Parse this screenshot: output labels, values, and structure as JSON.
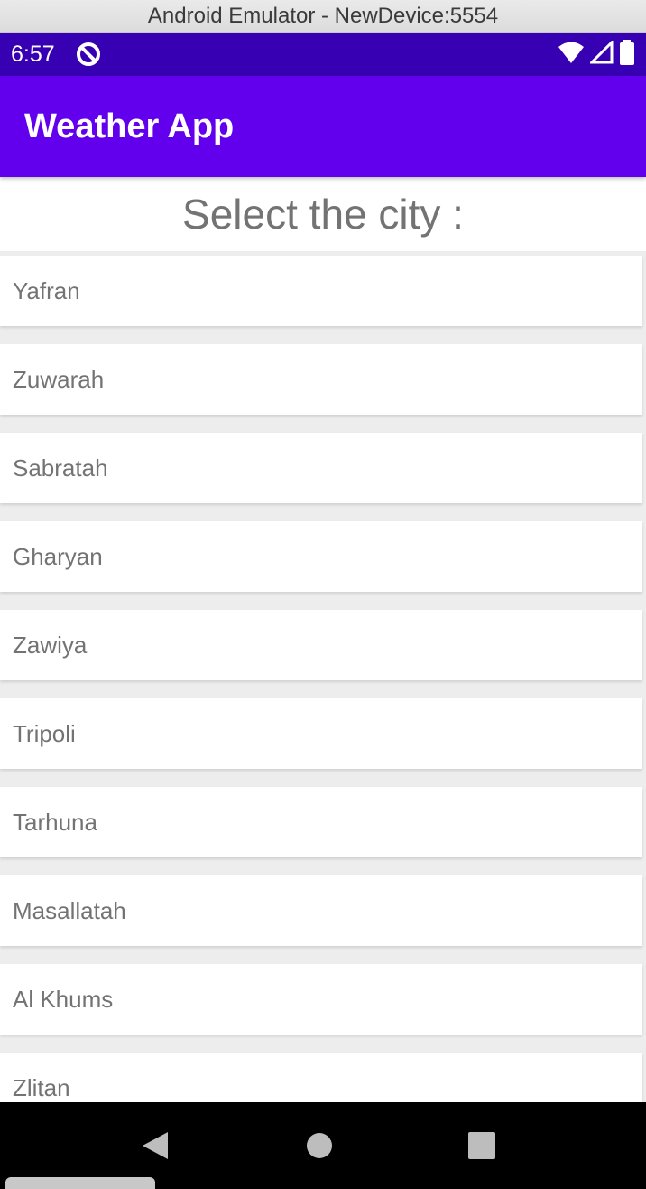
{
  "window": {
    "title": "Android Emulator - NewDevice:5554"
  },
  "status_bar": {
    "time": "6:57",
    "left_icon": "do-not-disturb-icon",
    "right_icons": [
      "wifi-icon",
      "signal-icon",
      "battery-icon"
    ]
  },
  "app_bar": {
    "title": "Weather App"
  },
  "main": {
    "prompt": "Select the city :",
    "cities": [
      {
        "label": "Yafran"
      },
      {
        "label": "Zuwarah"
      },
      {
        "label": "Sabratah"
      },
      {
        "label": "Gharyan"
      },
      {
        "label": "Zawiya"
      },
      {
        "label": "Tripoli"
      },
      {
        "label": "Tarhuna"
      },
      {
        "label": "Masallatah"
      },
      {
        "label": "Al Khums"
      },
      {
        "label": "Zlitan"
      }
    ]
  },
  "nav_bar": {
    "icons": [
      "back-icon",
      "home-icon",
      "recents-icon"
    ]
  },
  "colors": {
    "status_bar": "#3700b3",
    "app_bar": "#6200ee",
    "text_gray": "#737373",
    "list_background": "#ededed",
    "nav_bar": "#000000"
  }
}
